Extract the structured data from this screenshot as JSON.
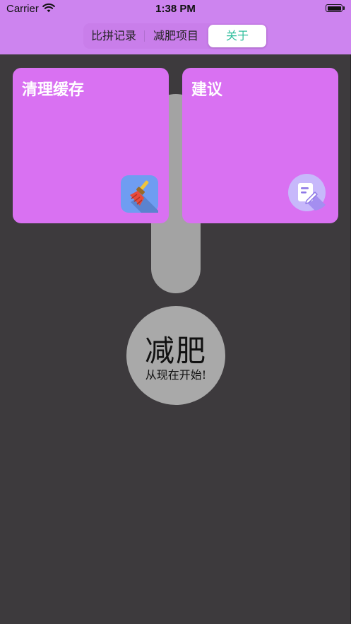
{
  "status_bar": {
    "carrier": "Carrier",
    "time": "1:38 PM",
    "wifi_icon": "wifi-icon",
    "battery_icon": "battery-icon"
  },
  "segments": [
    {
      "label": "比拼记录",
      "selected": false
    },
    {
      "label": "减肥项目",
      "selected": false
    },
    {
      "label": "关于",
      "selected": true
    }
  ],
  "cards": [
    {
      "title": "清理缓存",
      "icon": "broom-icon"
    },
    {
      "title": "建议",
      "icon": "note-edit-icon"
    }
  ],
  "decoration": {
    "big_text": "减肥",
    "small_text": "从现在开始!"
  },
  "colors": {
    "nav_bg": "#cd84ef",
    "page_bg": "#3d3a3d",
    "card_bg": "#d971f2",
    "selected_segment_text": "#2fbe9c"
  }
}
